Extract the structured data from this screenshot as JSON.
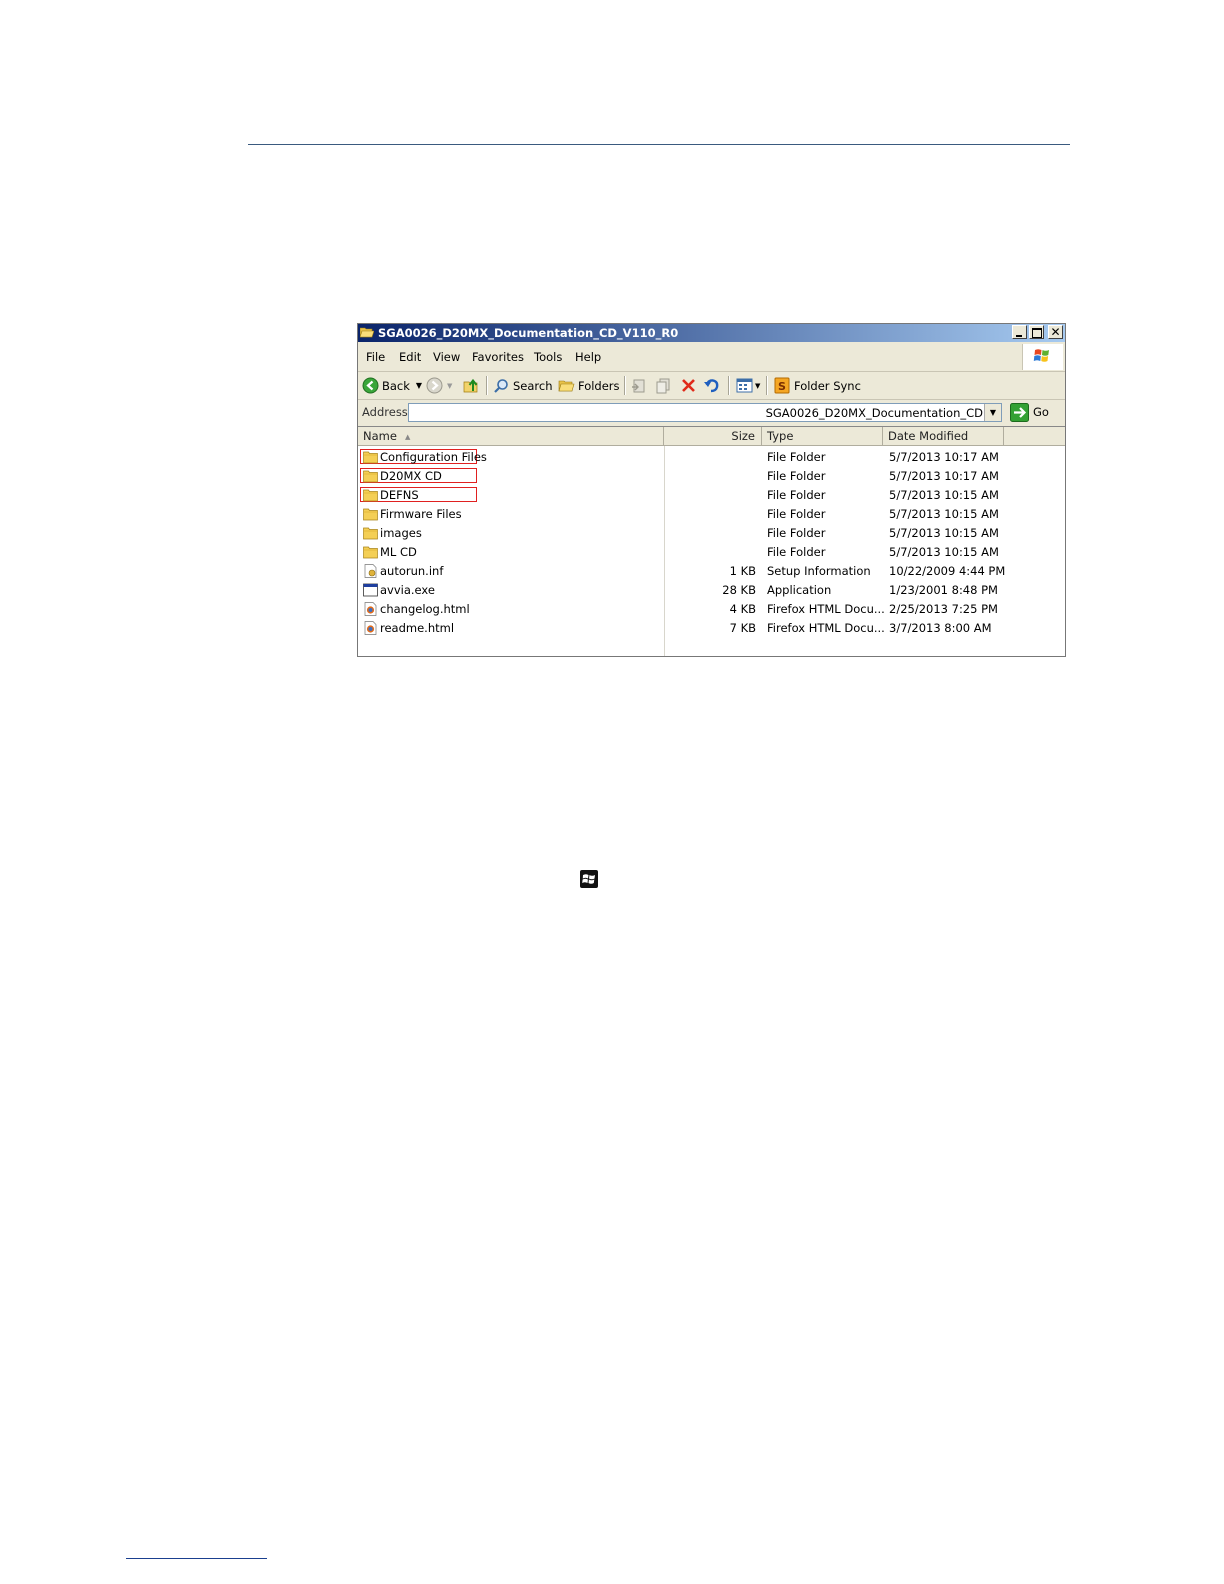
{
  "window": {
    "title": "SGA0026_D20MX_Documentation_CD_V110_R0",
    "menu": [
      "File",
      "Edit",
      "View",
      "Favorites",
      "Tools",
      "Help"
    ],
    "toolbar": {
      "back_label": "Back",
      "search_label": "Search",
      "folders_label": "Folders",
      "folder_sync_label": "Folder Sync"
    },
    "address": {
      "label": "Address",
      "value": "SGA0026_D20MX_Documentation_CD",
      "go_label": "Go"
    },
    "columns": {
      "name": "Name",
      "size": "Size",
      "type": "Type",
      "date": "Date Modified"
    },
    "files": [
      {
        "name": "Configuration Files",
        "size": "",
        "type": "File Folder",
        "date": "5/7/2013 10:17 AM",
        "icon": "folder-icon",
        "highlighted": true
      },
      {
        "name": "D20MX CD",
        "size": "",
        "type": "File Folder",
        "date": "5/7/2013 10:17 AM",
        "icon": "folder-icon",
        "highlighted": true
      },
      {
        "name": "DEFNS",
        "size": "",
        "type": "File Folder",
        "date": "5/7/2013 10:15 AM",
        "icon": "folder-icon",
        "highlighted": true
      },
      {
        "name": "Firmware Files",
        "size": "",
        "type": "File Folder",
        "date": "5/7/2013 10:15 AM",
        "icon": "folder-icon",
        "highlighted": false
      },
      {
        "name": "images",
        "size": "",
        "type": "File Folder",
        "date": "5/7/2013 10:15 AM",
        "icon": "folder-icon",
        "highlighted": false
      },
      {
        "name": "ML CD",
        "size": "",
        "type": "File Folder",
        "date": "5/7/2013 10:15 AM",
        "icon": "folder-icon",
        "highlighted": false
      },
      {
        "name": "autorun.inf",
        "size": "1 KB",
        "type": "Setup Information",
        "date": "10/22/2009 4:44 PM",
        "icon": "setup-file-icon",
        "highlighted": false
      },
      {
        "name": "avvia.exe",
        "size": "28 KB",
        "type": "Application",
        "date": "1/23/2001 8:48 PM",
        "icon": "application-icon",
        "highlighted": false
      },
      {
        "name": "changelog.html",
        "size": "4 KB",
        "type": "Firefox HTML Docu...",
        "date": "2/25/2013 7:25 PM",
        "icon": "firefox-html-icon",
        "highlighted": false
      },
      {
        "name": "readme.html",
        "size": "7 KB",
        "type": "Firefox HTML Docu...",
        "date": "3/7/2013 8:00 AM",
        "icon": "firefox-html-icon",
        "highlighted": false
      }
    ]
  },
  "colors": {
    "title_gradient_start": "#0a246a",
    "title_gradient_end": "#a6caf0",
    "highlight_box": "#e02020",
    "rule": "#3a5a7f"
  }
}
